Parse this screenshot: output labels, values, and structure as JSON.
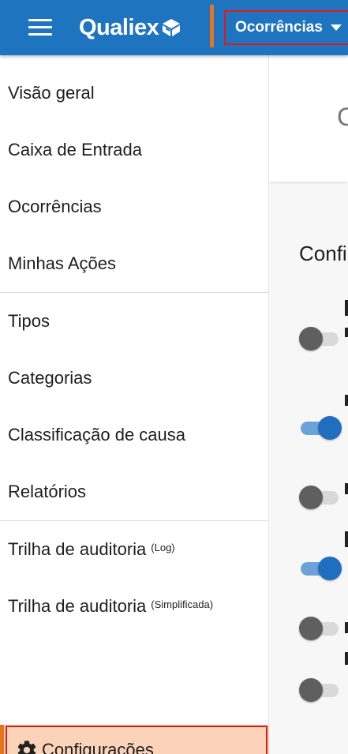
{
  "header": {
    "brand": "Qualiex",
    "module_selector": "Ocorrências",
    "brand_color": "#1f74c0",
    "accent_color": "#e8731c"
  },
  "sidebar": {
    "items": [
      {
        "label": "Visão geral"
      },
      {
        "label": "Caixa de Entrada"
      },
      {
        "label": "Ocorrências"
      },
      {
        "label": "Minhas Ações"
      },
      {
        "label": "Tipos"
      },
      {
        "label": "Categorias"
      },
      {
        "label": "Classificação de causa"
      },
      {
        "label": "Relatórios"
      },
      {
        "label": "Trilha de auditoria",
        "suffix": "(Log)"
      },
      {
        "label": "Trilha de auditoria",
        "suffix": "(Simplificada)"
      }
    ],
    "settings_label": "Configurações",
    "settings_highlight": "#fbd3b9"
  },
  "main": {
    "header_partial": "C",
    "section_title_partial": "Confi",
    "toggles": [
      {
        "state": "off"
      },
      {
        "state": "on"
      },
      {
        "state": "off"
      },
      {
        "state": "on"
      },
      {
        "state": "off"
      },
      {
        "state": "off"
      }
    ]
  }
}
